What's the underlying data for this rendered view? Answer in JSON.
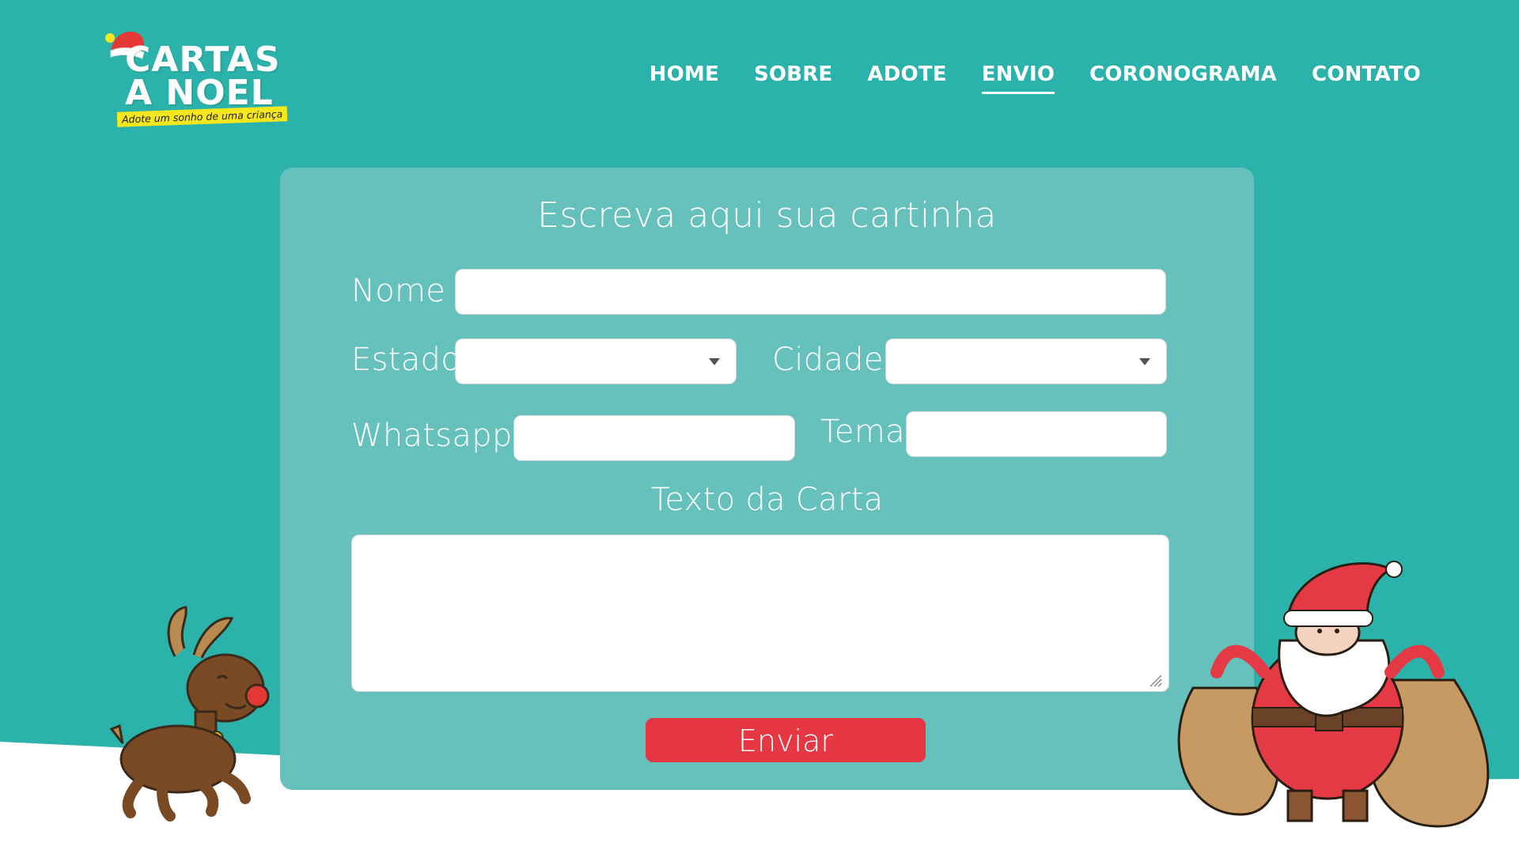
{
  "logo": {
    "line1": "CARTAS",
    "line2": "A NOEL",
    "tagline": "Adote um sonho de uma criança"
  },
  "nav": {
    "items": [
      {
        "label": "HOME",
        "active": false
      },
      {
        "label": "SOBRE",
        "active": false
      },
      {
        "label": "ADOTE",
        "active": false
      },
      {
        "label": "ENVIO",
        "active": true
      },
      {
        "label": "CORONOGRAMA",
        "active": false
      },
      {
        "label": "CONTATO",
        "active": false
      }
    ]
  },
  "form": {
    "title": "Escreva aqui sua cartinha",
    "nome_label": "Nome",
    "nome_value": "",
    "estado_label": "Estado",
    "estado_value": "",
    "cidade_label": "Cidade",
    "cidade_value": "",
    "whatsapp_label": "Whatsapp",
    "whatsapp_value": "",
    "tema_label": "Tema",
    "tema_value": "",
    "texto_label": "Texto da Carta",
    "texto_value": "",
    "submit_label": "Enviar"
  },
  "colors": {
    "background": "#2ab2ab",
    "panel": "#66c1bc",
    "button": "#e73745",
    "snow": "#ffffff",
    "logo_tag": "#f5e61d"
  },
  "icons": {
    "logo_hat": "santa-hat-icon",
    "select_caret": "caret-down-icon"
  }
}
